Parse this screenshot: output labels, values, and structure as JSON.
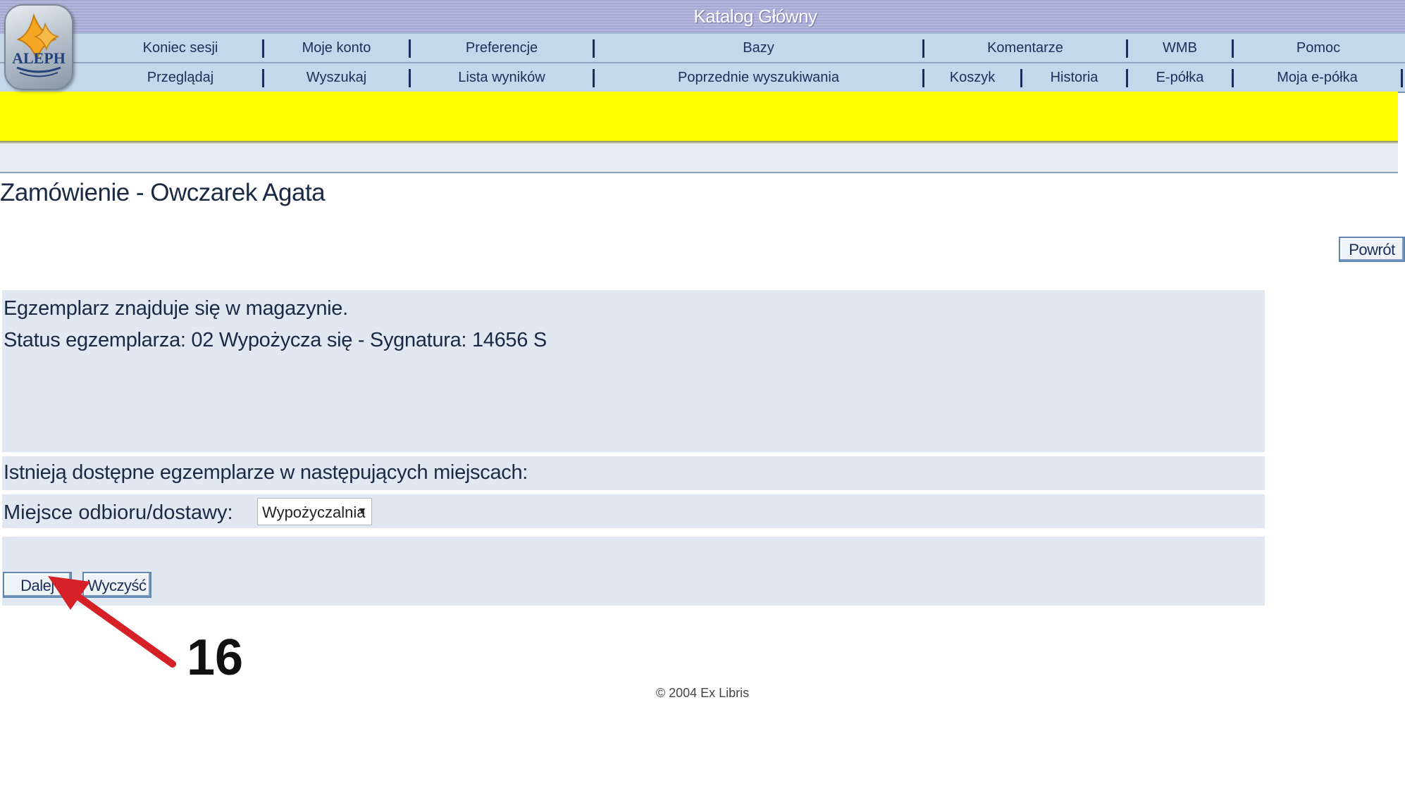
{
  "header": {
    "title": "Katalog Główny",
    "logo_text": "ALEPH"
  },
  "nav": {
    "row1": [
      "Koniec sesji",
      "Moje konto",
      "Preferencje",
      "Bazy",
      "Komentarze",
      "WMB",
      "Pomoc"
    ],
    "row2": [
      "Przeglądaj",
      "Wyszukaj",
      "Lista wyników",
      "Poprzednie wyszukiwania",
      "Koszyk",
      "Historia",
      "E-półka",
      "Moja e-półka"
    ]
  },
  "page": {
    "title": "Zamówienie - Owczarek Agata",
    "back_button": "Powrót"
  },
  "info": {
    "line1": "Egzemplarz znajduje się w magazynie.",
    "line2": "Status egzemplarza: 02 Wypożycza się - Sygnatura: 14656 S"
  },
  "availability": {
    "text": "Istnieją dostępne egzemplarze w następujących miejscach:"
  },
  "pickup": {
    "label": "Miejsce odbioru/dostawy:",
    "selected": "Wypożyczalnia"
  },
  "actions": {
    "next": "Dalej",
    "clear": "Wyczyść"
  },
  "annotation": {
    "step_number": "16",
    "arrow_color": "#d42026"
  },
  "footer": {
    "copyright": "© 2004 Ex Libris"
  },
  "colors": {
    "title_bar": "#a4a8d2",
    "nav_bg": "#c3d8ea",
    "highlight_band": "#ffff00",
    "panel_bg": "#e2e8f2",
    "text": "#1a2a44"
  }
}
